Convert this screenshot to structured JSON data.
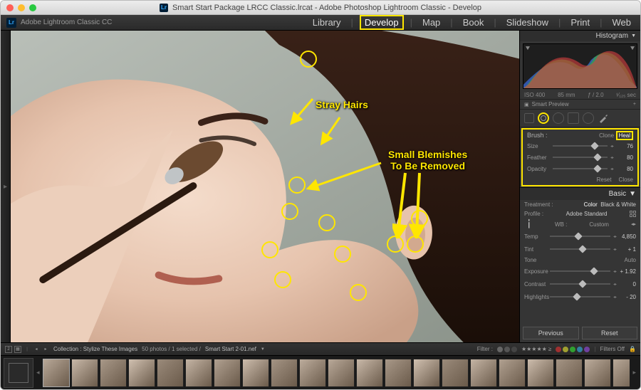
{
  "window": {
    "title": "Smart Start Package LRCC Classic.lrcat - Adobe Photoshop Lightroom Classic - Develop"
  },
  "brand": "Adobe Lightroom Classic CC",
  "modules": {
    "library": "Library",
    "develop": "Develop",
    "map": "Map",
    "book": "Book",
    "slideshow": "Slideshow",
    "print": "Print",
    "web": "Web"
  },
  "annotations": {
    "stray_hairs": "Stray Hairs",
    "blemishes_l1": "Small Blemishes",
    "blemishes_l2": "To Be Removed"
  },
  "panels": {
    "histogram": "Histogram",
    "histo_info": {
      "iso": "ISO 400",
      "focal": "85 mm",
      "aperture": "ƒ / 2.0",
      "shutter": "¹⁄₁₂₅ sec"
    },
    "smart_preview": "Smart Preview",
    "brush": {
      "label": "Brush :",
      "clone": "Clone",
      "heal": "Heal",
      "size_l": "Size",
      "size_v": "76",
      "feather_l": "Feather",
      "feather_v": "80",
      "opacity_l": "Opacity",
      "opacity_v": "80",
      "reset": "Reset",
      "close": "Close"
    },
    "basic": {
      "title": "Basic",
      "treatment_l": "Treatment :",
      "color": "Color",
      "bw": "Black & White",
      "profile_l": "Profile :",
      "profile_v": "Adobe Standard",
      "wb_l": "WB :",
      "wb_v": "Custom",
      "temp_l": "Temp",
      "temp_v": "4,850",
      "tint_l": "Tint",
      "tint_v": "+ 1",
      "tone_l": "Tone",
      "auto": "Auto",
      "exposure_l": "Exposure",
      "exposure_v": "+ 1.92",
      "contrast_l": "Contrast",
      "contrast_v": "0",
      "highlights_l": "Highlights",
      "highlights_v": "- 20"
    },
    "buttons": {
      "previous": "Previous",
      "reset": "Reset"
    }
  },
  "toolbar": {
    "collection_l": "Collection : Stylize These Images",
    "count": "50 photos / 1 selected /",
    "filename": "Smart Start 2-01.nef",
    "filter_l": "Filter :",
    "filters_off": "Filters Off"
  }
}
